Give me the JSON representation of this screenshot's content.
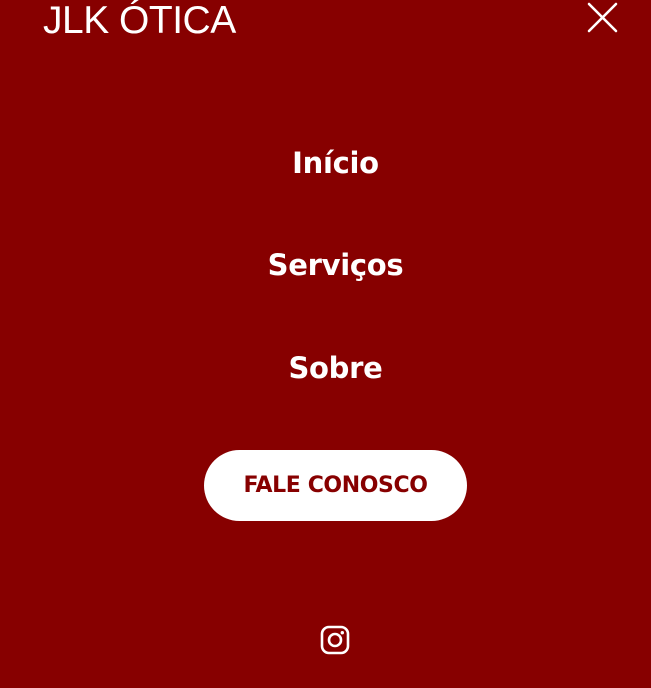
{
  "header": {
    "brand": "JLK ÓTICA",
    "close_icon": "close-icon"
  },
  "menu": {
    "items": [
      {
        "label": "Início"
      },
      {
        "label": "Serviços"
      },
      {
        "label": "Sobre"
      }
    ],
    "cta_label": "FALE CONOSCO"
  },
  "social": {
    "icon": "instagram-icon"
  },
  "colors": {
    "background": "#870000",
    "text": "#ffffff",
    "cta_background": "#ffffff",
    "cta_text": "#870000"
  }
}
